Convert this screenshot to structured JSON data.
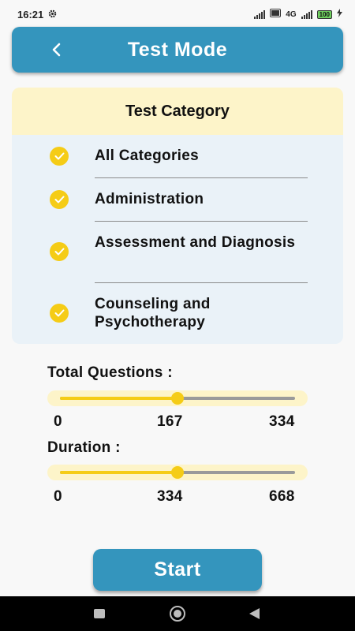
{
  "status_bar": {
    "time": "16:21",
    "network": "4G",
    "battery": "100"
  },
  "header": {
    "title": "Test Mode"
  },
  "test_category": {
    "title": "Test Category",
    "items": [
      {
        "label": "All Categories",
        "checked": true
      },
      {
        "label": "Administration",
        "checked": true
      },
      {
        "label": "Assessment and Diagnosis",
        "checked": true
      },
      {
        "label": "Counseling and Psychotherapy",
        "checked": true
      }
    ]
  },
  "total_questions": {
    "label": "Total Questions :",
    "min": "0",
    "value": "167",
    "max": "334"
  },
  "duration": {
    "label": "Duration :",
    "min": "0",
    "value": "334",
    "max": "668"
  },
  "start_label": "Start",
  "colors": {
    "primary": "#3495bd",
    "accent": "#f5cc16",
    "highlight": "#fdf4c9",
    "card": "#eaf2f8"
  }
}
